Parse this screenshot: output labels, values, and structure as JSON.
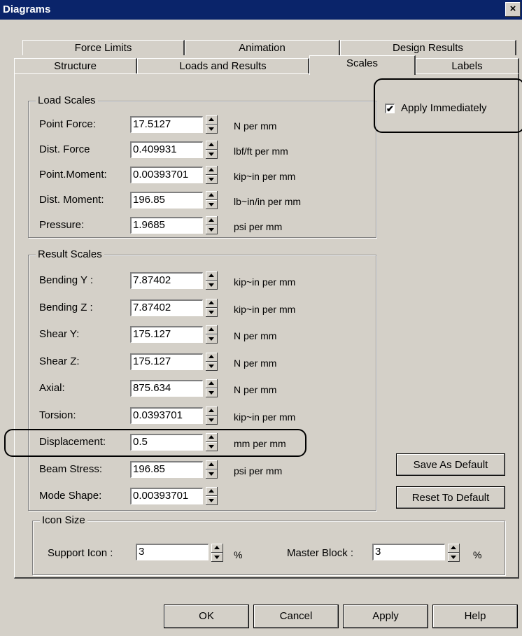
{
  "window": {
    "title": "Diagrams",
    "close_glyph": "×"
  },
  "tabs": {
    "row1": [
      "Force Limits",
      "Animation",
      "Design Results"
    ],
    "row2": [
      "Structure",
      "Loads and Results",
      "Scales",
      "Labels"
    ],
    "selected": "Scales"
  },
  "load_scales": {
    "title": "Load Scales",
    "rows": [
      {
        "label": "Point Force:",
        "value": "17.5127",
        "unit": "N per mm"
      },
      {
        "label": "Dist. Force",
        "value": "0.409931",
        "unit": "lbf/ft per mm"
      },
      {
        "label": "Point.Moment:",
        "value": "0.00393701",
        "unit": "kip~in per mm"
      },
      {
        "label": "Dist. Moment:",
        "value": "196.85",
        "unit": "lb~in/in per mm"
      },
      {
        "label": "Pressure:",
        "value": "1.9685",
        "unit": "psi per mm"
      }
    ]
  },
  "result_scales": {
    "title": "Result Scales",
    "rows": [
      {
        "label": "Bending Y :",
        "value": "7.87402",
        "unit": "kip~in per mm"
      },
      {
        "label": "Bending Z :",
        "value": "7.87402",
        "unit": "kip~in per mm"
      },
      {
        "label": "Shear Y:",
        "value": "175.127",
        "unit": "N per mm"
      },
      {
        "label": "Shear Z:",
        "value": "175.127",
        "unit": "N per mm"
      },
      {
        "label": "Axial:",
        "value": "875.634",
        "unit": "N per mm"
      },
      {
        "label": "Torsion:",
        "value": "0.0393701",
        "unit": "kip~in per mm"
      },
      {
        "label": "Displacement:",
        "value": "0.5",
        "unit": "mm per mm"
      },
      {
        "label": "Beam Stress:",
        "value": "196.85",
        "unit": "psi per mm"
      },
      {
        "label": "Mode Shape:",
        "value": "0.00393701",
        "unit": ""
      }
    ]
  },
  "apply_immediately": {
    "label": "Apply Immediately",
    "checked": true,
    "mark": "✔"
  },
  "side_buttons": {
    "save_default": "Save As Default",
    "reset_default": "Reset To Default"
  },
  "icon_size": {
    "title": "Icon Size",
    "support_label": "Support Icon :",
    "support_value": "3",
    "support_unit": "%",
    "master_label": "Master Block :",
    "master_value": "3",
    "master_unit": "%"
  },
  "footer": {
    "ok": "OK",
    "cancel": "Cancel",
    "apply": "Apply",
    "help": "Help"
  }
}
